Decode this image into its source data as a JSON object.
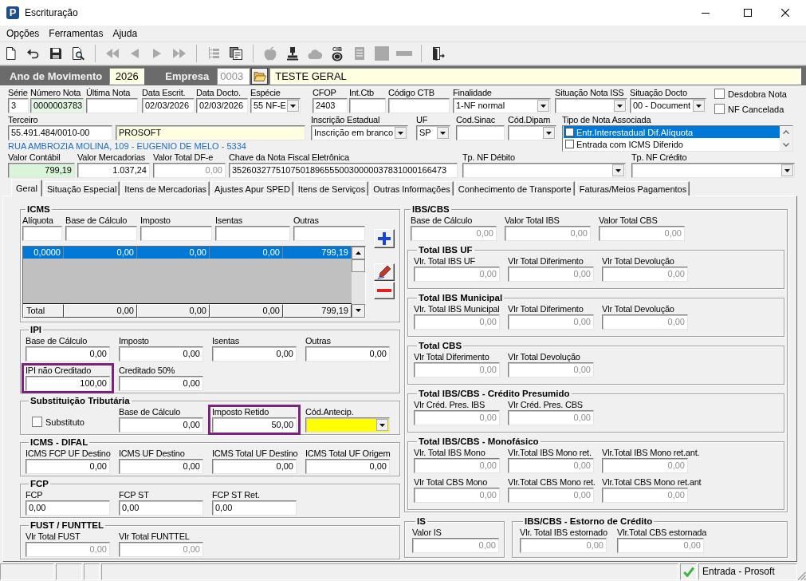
{
  "window": {
    "logo": "P",
    "title": "Escrituração"
  },
  "menu": [
    "Opções",
    "Ferramentas",
    "Ajuda"
  ],
  "toolbar": [
    {
      "kind": "new",
      "disabled": false
    },
    {
      "kind": "undo",
      "disabled": false
    },
    {
      "kind": "save",
      "disabled": false
    },
    {
      "kind": "preview",
      "disabled": false
    },
    {
      "kind": "separator"
    },
    {
      "kind": "first",
      "disabled": true
    },
    {
      "kind": "previous",
      "disabled": true
    },
    {
      "kind": "next",
      "disabled": true
    },
    {
      "kind": "last",
      "disabled": true
    },
    {
      "kind": "separator"
    },
    {
      "kind": "tree",
      "disabled": true
    },
    {
      "kind": "report",
      "disabled": false
    },
    {
      "kind": "separator"
    },
    {
      "kind": "apple",
      "disabled": true
    },
    {
      "kind": "stamp",
      "disabled": false
    },
    {
      "kind": "cloud",
      "disabled": true
    },
    {
      "kind": "coin",
      "disabled": false,
      "caption": "CIB"
    },
    {
      "kind": "document",
      "disabled": true
    },
    {
      "kind": "block",
      "disabled": true
    },
    {
      "kind": "bar",
      "disabled": true
    },
    {
      "kind": "separator"
    },
    {
      "kind": "exit",
      "disabled": false
    }
  ],
  "year_bar": {
    "year_label": "Ano de Movimento",
    "year": "2026",
    "company_label": "Empresa",
    "company_code": "0003",
    "company_code_disabled": true,
    "company_name": "TESTE GERAL"
  },
  "header": {
    "rows": [
      {
        "fields": [
          {
            "label": "Série",
            "value": "3",
            "kind": "text"
          },
          {
            "label": "Número Nota",
            "value": "0000003783",
            "kind": "text",
            "color": "#e4f7e4"
          },
          {
            "label": "Última Nota",
            "kind": "text"
          },
          {
            "label": "Data Escrit.",
            "value": "02/03/2026",
            "kind": "text"
          },
          {
            "label": "Data Docto.",
            "value": "02/03/2026",
            "kind": "text"
          },
          {
            "label": "Espécie",
            "value": "55 NF-E",
            "kind": "select"
          },
          {
            "label": "CFOP",
            "value": "2403",
            "kind": "text"
          },
          {
            "label": "Int.Ctb",
            "kind": "text"
          },
          {
            "label": "Código CTB",
            "kind": "text"
          },
          {
            "label": "Finalidade",
            "value": "1-NF normal",
            "kind": "select"
          },
          {
            "label": "Situação Nota ISS",
            "kind": "select"
          },
          {
            "label": "Situação Docto",
            "value": "00 - Document",
            "kind": "select"
          }
        ],
        "checkboxes": [
          {
            "label": "Desdobra Nota",
            "checked": false
          },
          {
            "label": "NF Cancelada",
            "checked": false
          }
        ]
      },
      {
        "fields": [
          {
            "label": "Terceiro",
            "value": "55.491.484/0010-00",
            "kind": "text"
          },
          {
            "value": "PROSOFT",
            "kind": "text",
            "color": "#ffffe1"
          },
          {
            "label": "Inscrição Estadual",
            "value": "Inscrição em branco",
            "kind": "select"
          },
          {
            "label": "UF",
            "value": "SP",
            "kind": "select"
          },
          {
            "label": "Cod.Sinac",
            "kind": "text"
          },
          {
            "label": "Cód.Dipam",
            "kind": "select"
          }
        ],
        "address": "RUA AMBROZIA MOLINA, 109 - EUGENIO DE MELO - 5334",
        "note_types": {
          "label": "Tipo de Nota Associada",
          "items": [
            {
              "label": "Entr.Interestadual Dif.Alíquota",
              "checked": false,
              "selected": true
            },
            {
              "label": "Entrada com ICMS Diferido",
              "checked": false,
              "selected": false
            }
          ]
        }
      },
      {
        "fields": [
          {
            "label": "Valor Contábil",
            "value": "799,19",
            "kind": "number",
            "color": "#d9f5d9"
          },
          {
            "label": "Valor Mercadorias",
            "value": "1.037,24",
            "kind": "number"
          },
          {
            "label": "Valor Total DF-e",
            "value": "0,00",
            "kind": "number",
            "disabled": true
          },
          {
            "label": "Chave da Nota Fiscal Eletrônica",
            "value": "35260327751075018965550030000037831000166473",
            "kind": "text"
          },
          {
            "label": "Tp. NF Débito",
            "kind": "select"
          },
          {
            "label": "Tp. NF Crédito",
            "kind": "select"
          }
        ]
      }
    ]
  },
  "tabs": [
    {
      "label": "Geral",
      "selected": true
    },
    {
      "label": "Situação Especial",
      "selected": false
    },
    {
      "label": "Itens de Mercadorias",
      "selected": false
    },
    {
      "label": "Ajustes Apur SPED",
      "selected": false
    },
    {
      "label": "Itens de Serviços",
      "selected": false
    },
    {
      "label": "Outras Informações",
      "selected": false
    },
    {
      "label": "Conhecimento de Transporte",
      "selected": false
    },
    {
      "label": "Faturas/Meios Pagamentos",
      "selected": false
    }
  ],
  "left_groups": [
    {
      "kind": "grid",
      "title": "ICMS",
      "rows": [
        [
          {
            "label": "Alíquota",
            "kind": "number"
          },
          {
            "label": "Base de Cálculo",
            "kind": "number"
          },
          {
            "label": "Imposto",
            "kind": "number"
          },
          {
            "label": "Isentas",
            "kind": "number"
          },
          {
            "label": "Outras",
            "kind": "number"
          }
        ]
      ],
      "table": {
        "rows": [
          {
            "cells": [
              "0,0000",
              "0,00",
              "0,00",
              "0,00",
              "799,19"
            ],
            "selected": true
          }
        ],
        "total": [
          "Total",
          "0,00",
          "0,00",
          "0,00",
          "799,19"
        ]
      }
    },
    {
      "kind": "fields",
      "title": "IPI",
      "disabled": false,
      "rows": [
        [
          {
            "label": "Base de Cálculo",
            "value": "0,00",
            "kind": "number",
            "highlighted": false
          },
          {
            "label": "Imposto",
            "value": "0,00",
            "kind": "number",
            "highlighted": false
          },
          {
            "label": "Isentas",
            "value": "0,00",
            "kind": "number",
            "highlighted": false
          },
          {
            "label": "Outras",
            "value": "0,00",
            "kind": "number",
            "highlighted": false
          }
        ],
        [
          {
            "label": "IPI não Creditado",
            "value": "100,00",
            "kind": "number",
            "highlighted": true
          },
          {
            "label": "Creditado 50%",
            "value": "0,00",
            "kind": "number",
            "highlighted": false
          }
        ]
      ]
    },
    {
      "kind": "fields",
      "title": "Substituição Tributária",
      "disabled": false,
      "rows": [
        [
          {
            "label": "Substituto",
            "kind": "checkbox",
            "checked": false,
            "highlighted": false
          },
          {
            "label": "Base de Cálculo",
            "value": "0,00",
            "kind": "number",
            "highlighted": false
          },
          {
            "label": "Imposto Retido",
            "value": "50,00",
            "kind": "number",
            "highlighted": true
          },
          {
            "label": "Cód.Antecip.",
            "kind": "select",
            "color": "#ffff00",
            "highlighted": false
          }
        ]
      ]
    },
    {
      "kind": "fields",
      "title": "ICMS - DIFAL",
      "disabled": false,
      "rows": [
        [
          {
            "label": "ICMS FCP UF Destino",
            "value": "0,00",
            "kind": "number"
          },
          {
            "label": "ICMS UF Destino",
            "value": "0,00",
            "kind": "number"
          },
          {
            "label": "ICMS Total UF Destino",
            "value": "0,00",
            "kind": "number"
          },
          {
            "label": "ICMS Total UF Origem",
            "value": "0,00",
            "kind": "number"
          }
        ]
      ]
    },
    {
      "kind": "fields",
      "title": "FCP",
      "disabled": false,
      "rows": [
        [
          {
            "label": "FCP",
            "value": "0,00",
            "kind": "text"
          },
          {
            "label": "FCP ST",
            "value": "0,00",
            "kind": "text"
          },
          {
            "label": "FCP ST Ret.",
            "value": "0,00",
            "kind": "text"
          }
        ]
      ]
    },
    {
      "kind": "fields",
      "title": "FUST / FUNTTEL",
      "disabled": true,
      "rows": [
        [
          {
            "label": "Vlr Total FUST",
            "value": "0,00",
            "kind": "number"
          },
          {
            "label": "Vlr Total FUNTTEL",
            "value": "0,00",
            "kind": "number"
          }
        ]
      ]
    }
  ],
  "right_group": {
    "title": "IBS/CBS",
    "disabled": true,
    "rows": [
      [
        {
          "label": "Base de Cálculo",
          "value": "0,00",
          "kind": "number"
        },
        {
          "label": "Valor Total IBS",
          "value": "0,00",
          "kind": "number"
        },
        {
          "label": "Valor Total CBS",
          "value": "0,00",
          "kind": "number"
        }
      ]
    ],
    "groups": [
      {
        "title": "Total IBS UF",
        "disabled": true,
        "rows": [
          [
            {
              "label": "Vlr. Total IBS UF",
              "value": "0,00",
              "kind": "number"
            },
            {
              "label": "Vlr Total Diferimento",
              "value": "0,00",
              "kind": "number"
            },
            {
              "label": "Vlr Total Devolução",
              "value": "0,00",
              "kind": "number"
            }
          ]
        ]
      },
      {
        "title": "Total IBS Municipal",
        "disabled": true,
        "rows": [
          [
            {
              "label": "Vlr. Total IBS Municipal",
              "value": "0,00",
              "kind": "number"
            },
            {
              "label": "Vlr Total Diferimento",
              "value": "0,00",
              "kind": "number"
            },
            {
              "label": "Vlr Total Devolução",
              "value": "0,00",
              "kind": "number"
            }
          ]
        ]
      },
      {
        "title": "Total CBS",
        "disabled": true,
        "rows": [
          [
            {
              "label": "Vlr Total Diferimento",
              "value": "0,00",
              "kind": "number"
            },
            {
              "label": "Vlr Total Devolução",
              "value": "0,00",
              "kind": "number"
            }
          ]
        ]
      },
      {
        "title": "Total IBS/CBS - Crédito Presumido",
        "disabled": true,
        "rows": [
          [
            {
              "label": "Vlr Créd. Pres. IBS",
              "value": "0,00",
              "kind": "number"
            },
            {
              "label": "Vlr Créd. Pres. CBS",
              "value": "0,00",
              "kind": "number"
            }
          ]
        ]
      },
      {
        "title": "Total IBS/CBS - Monofásico",
        "disabled": true,
        "rows": [
          [
            {
              "label": "Vlr. Total IBS Mono",
              "value": "0,00",
              "kind": "number"
            },
            {
              "label": "Vlr.Total IBS Mono ret.",
              "value": "0,00",
              "kind": "number"
            },
            {
              "label": "Vlr.Total IBS Mono ret.ant.",
              "value": "0,00",
              "kind": "number"
            }
          ],
          [
            {
              "label": "Vlr Total CBS Mono",
              "value": "0,00",
              "kind": "number"
            },
            {
              "label": "Vlr.Total CBS Mono ret.",
              "value": "0,00",
              "kind": "number"
            },
            {
              "label": "Vlr.Total CBS Mono ret.ant",
              "value": "0,00",
              "kind": "number"
            }
          ]
        ]
      }
    ]
  },
  "bottom_groups": [
    {
      "title": "IS",
      "disabled": true,
      "rows": [
        [
          {
            "label": "Valor IS",
            "value": "0,00",
            "kind": "number"
          }
        ]
      ]
    },
    {
      "title": "IBS/CBS - Estorno de Crédito",
      "disabled": true,
      "rows": [
        [
          {
            "label": "Vlr. Total IBS estornado",
            "value": "0,00",
            "kind": "number"
          },
          {
            "label": "Vlr.Total CBS estornada",
            "value": "0,00",
            "kind": "number"
          }
        ]
      ]
    }
  ],
  "status_bar": {
    "text": "Entrada - Prosoft"
  }
}
